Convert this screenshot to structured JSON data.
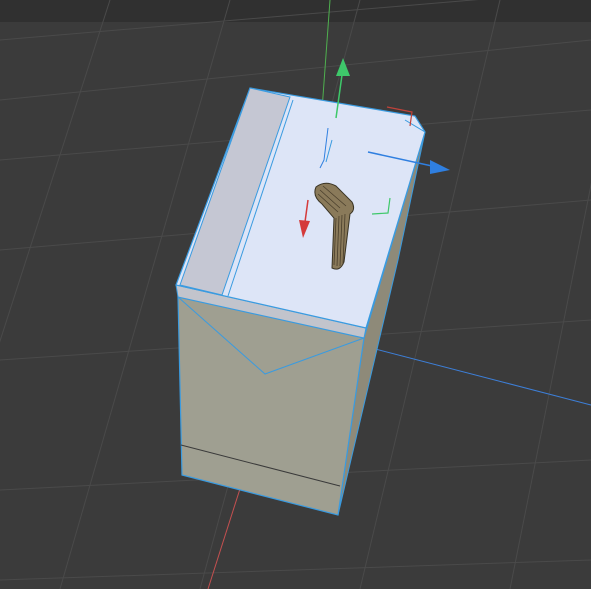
{
  "viewport": {
    "background_color": "#3b3b3b",
    "header_bar_color": "#303030",
    "grid_color": "#4a4a4a",
    "selection_outline_color": "#3a9be0"
  },
  "axes": {
    "x_axis_color": "#c45050",
    "y_axis_color": "#4fb04f",
    "z_axis_color": "#3d7fd8"
  },
  "gizmo": {
    "type": "translate",
    "y_arrow_color": "#3ec86a",
    "z_arrow_color": "#2f7fe0",
    "x_arrow_color": "#d43a3a",
    "center_icon": "gizmo-center-icon"
  },
  "object": {
    "name_icon": "box-mesh-icon",
    "front_face_color": "#9f9f92",
    "top_face_color": "#dce4f6",
    "side_face_color": "#8f8a7a",
    "lid_side_color": "#c8cad6",
    "handle_color": "#8a7a5a",
    "handle_icon": "lever-handle-icon"
  }
}
